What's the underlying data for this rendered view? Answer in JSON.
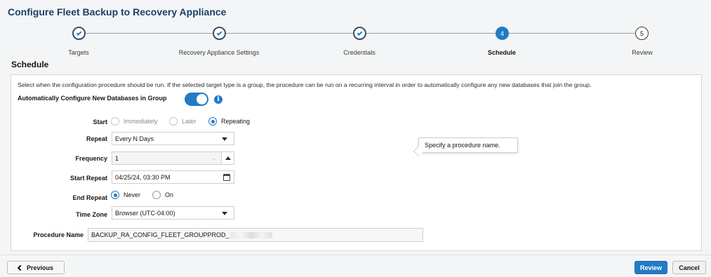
{
  "page_title": "Configure Fleet Backup to Recovery Appliance",
  "train": {
    "steps": [
      {
        "label": "Targets",
        "state": "done",
        "number": ""
      },
      {
        "label": "Recovery Appliance Settings",
        "state": "done",
        "number": ""
      },
      {
        "label": "Credentials",
        "state": "done",
        "number": ""
      },
      {
        "label": "Schedule",
        "state": "current",
        "number": "4"
      },
      {
        "label": "Review",
        "state": "future",
        "number": "5"
      }
    ]
  },
  "section_title": "Schedule",
  "description": "Select when the configuration procedure should be run. If the selected target type is a group, the procedure can be run on a recurring interval in order to automatically configure any new databases that join the group.",
  "auto_configure": {
    "label": "Automatically Configure New Databases in Group",
    "enabled": true,
    "info_icon": "info-icon"
  },
  "form": {
    "start": {
      "label": "Start",
      "options": [
        "Immediately",
        "Later",
        "Repeating"
      ],
      "selected": "Repeating"
    },
    "repeat": {
      "label": "Repeat",
      "value": "Every N Days"
    },
    "frequency": {
      "label": "Frequency",
      "value": "1"
    },
    "start_repeat": {
      "label": "Start Repeat",
      "value": "04/25/24, 03:30 PM"
    },
    "end_repeat": {
      "label": "End Repeat",
      "options": [
        "Never",
        "On"
      ],
      "selected": "Never"
    },
    "time_zone": {
      "label": "Time Zone",
      "value": "Browser (UTC-04:00)"
    },
    "procedure_name": {
      "label": "Procedure Name",
      "value": "BACKUP_RA_CONFIG_FLEET_GROUPPROD_"
    }
  },
  "tooltip": "Specify a procedure name.",
  "footer": {
    "previous_label": "Previous",
    "review_label": "Review",
    "cancel_label": "Cancel"
  },
  "colors": {
    "accent": "#227bc6",
    "title": "#1b3f68"
  }
}
